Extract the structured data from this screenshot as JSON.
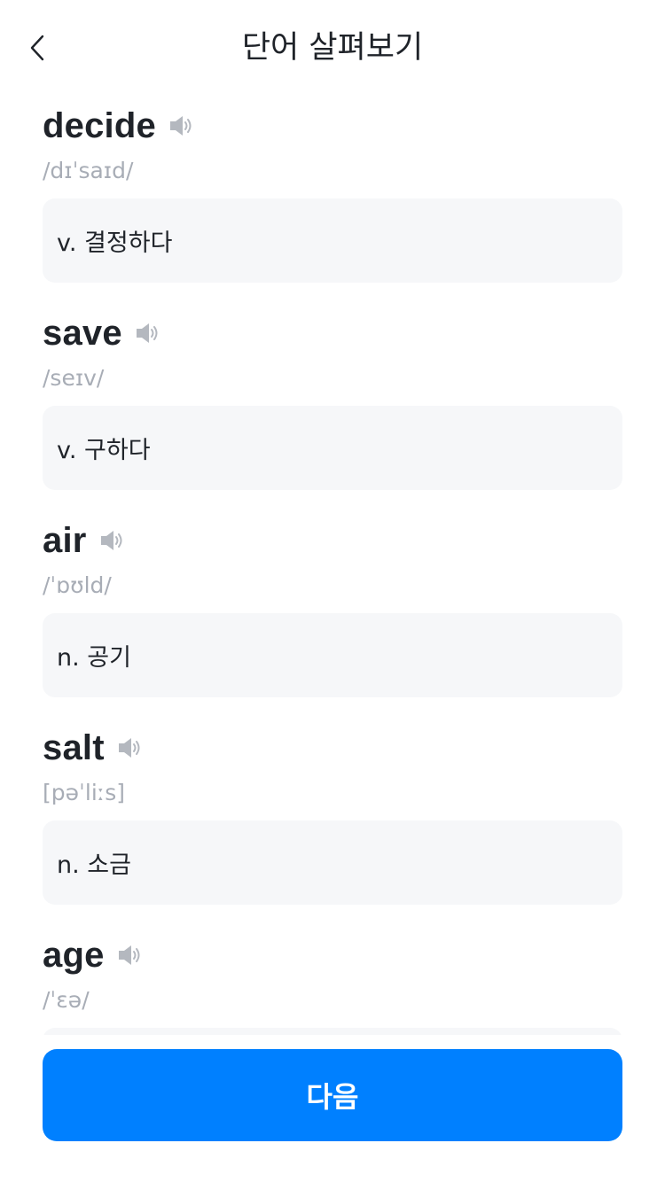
{
  "header": {
    "title": "단어 살펴보기",
    "back_icon": "chevron-left-icon"
  },
  "words": [
    {
      "word": "decide",
      "phonetic": "/dɪˈsaɪd/",
      "meaning": "v. 결정하다"
    },
    {
      "word": "save",
      "phonetic": "/seɪv/",
      "meaning": "v. 구하다"
    },
    {
      "word": "air",
      "phonetic": "/ˈɒʊld/",
      "meaning": "n. 공기"
    },
    {
      "word": "salt",
      "phonetic": "[pəˈliːs]",
      "meaning": "n. 소금"
    },
    {
      "word": "age",
      "phonetic": "/ˈɛə/",
      "meaning": ""
    }
  ],
  "footer": {
    "next_label": "다음"
  },
  "colors": {
    "accent": "#0080ff",
    "text": "#1f2329",
    "phonetic": "#a8adb6",
    "card_bg": "#f6f7f9",
    "icon": "#b4b8bf"
  },
  "icons": {
    "speaker": "speaker-icon"
  }
}
